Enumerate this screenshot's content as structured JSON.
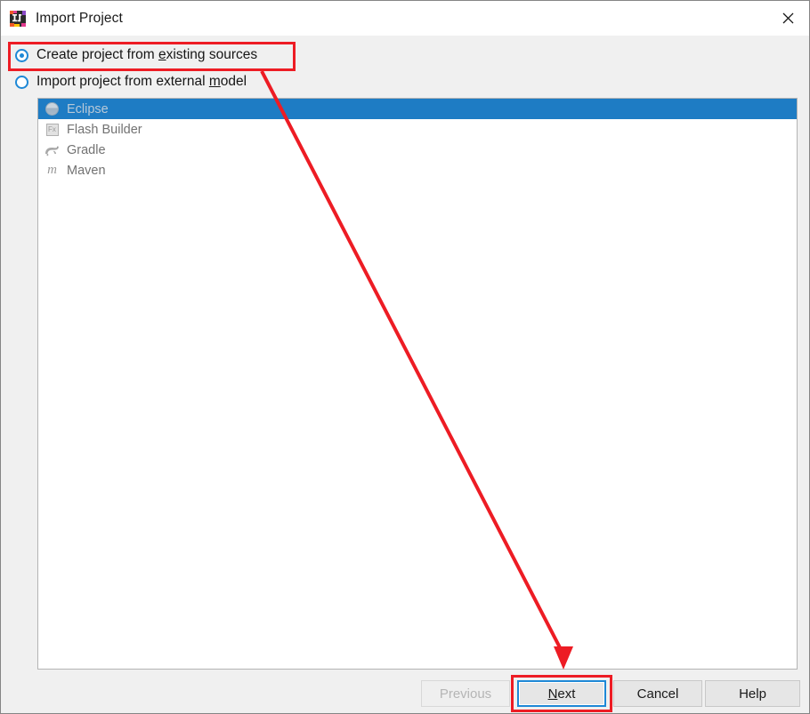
{
  "window": {
    "title": "Import Project",
    "app_icon": "intellij-idea-icon",
    "close_icon": "close-icon"
  },
  "options": {
    "existing": {
      "label_before": "Create project from ",
      "mnemonic": "e",
      "label_after": "xisting sources",
      "selected": true
    },
    "external": {
      "label_before": "Import project from external ",
      "mnemonic": "m",
      "label_after": "odel",
      "selected": false
    }
  },
  "model_list": {
    "items": [
      {
        "label": "Eclipse",
        "icon": "eclipse-icon",
        "selected": true
      },
      {
        "label": "Flash Builder",
        "icon": "flash-builder-icon",
        "selected": false
      },
      {
        "label": "Gradle",
        "icon": "gradle-icon",
        "selected": false
      },
      {
        "label": "Maven",
        "icon": "maven-icon",
        "selected": false
      }
    ]
  },
  "buttons": {
    "previous": "Previous",
    "next_before": "",
    "next_mnemonic": "N",
    "next_after": "ext",
    "next_label": "Next",
    "cancel": "Cancel",
    "help": "Help"
  },
  "annotations": {
    "highlight_color": "#ed1c24",
    "arrow_from": "Create project from existing sources",
    "arrow_to": "Next"
  },
  "colors": {
    "accent_blue": "#1e88d6",
    "selection_blue": "#1e7cc4",
    "dialog_bg": "#f0f0f0",
    "annotation_red": "#ed1c24"
  }
}
